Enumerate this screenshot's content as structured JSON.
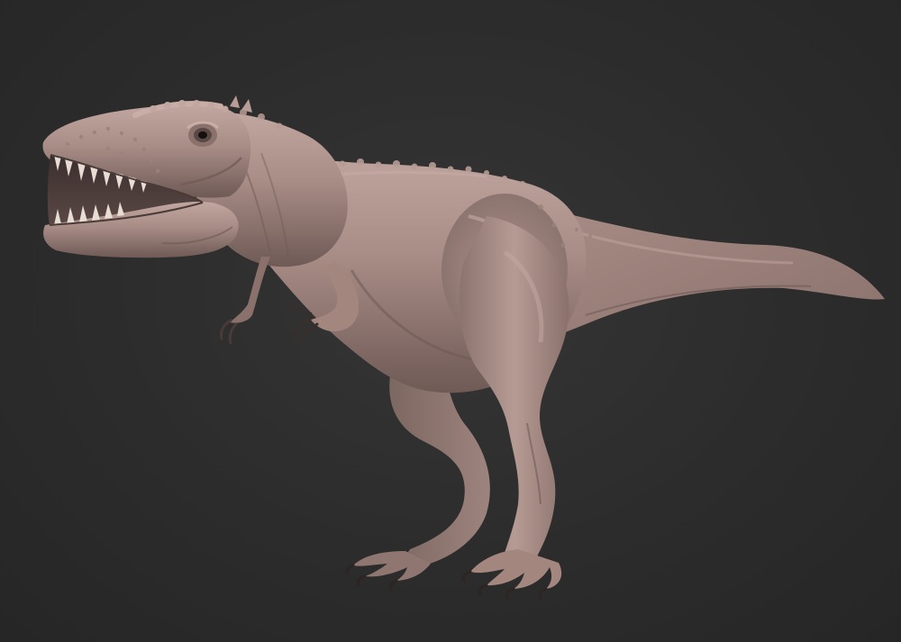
{
  "scene": {
    "subject_icon": "dinosaur-sculpt",
    "colors": {
      "background": "#2d2d2d",
      "clay_base": "#a88c86",
      "clay_light": "#c4aaa3",
      "clay_shadow": "#6f5a56",
      "clay_deep": "#4a3b39",
      "teeth": "#e8ddd4",
      "eye": "#141010"
    }
  }
}
